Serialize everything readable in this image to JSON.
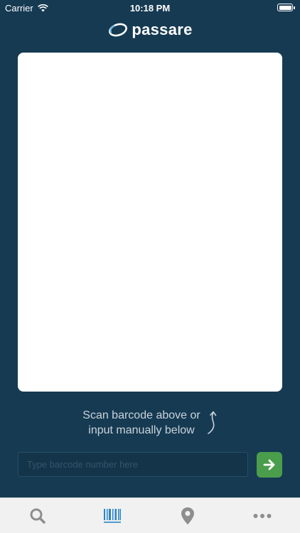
{
  "status_bar": {
    "carrier": "Carrier",
    "time": "10:18 PM"
  },
  "header": {
    "logo_text": "passare"
  },
  "scanner": {
    "hint_line1": "Scan barcode above or",
    "hint_line2": "input manually below"
  },
  "manual_entry": {
    "value": "",
    "placeholder": "Type barcode number here"
  },
  "tab_bar": {
    "items": [
      {
        "icon": "search-icon",
        "active": false
      },
      {
        "icon": "barcode-icon",
        "active": true
      },
      {
        "icon": "map-pin-icon",
        "active": false
      },
      {
        "icon": "more-icon",
        "active": false
      }
    ]
  },
  "colors": {
    "background": "#163a52",
    "accent_green": "#4a9d4b",
    "active_tab": "#2a86c5",
    "inactive_tab": "#8e8e8e"
  }
}
